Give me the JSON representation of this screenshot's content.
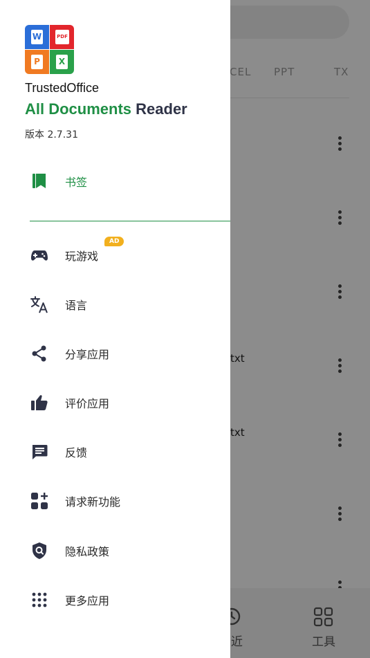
{
  "background": {
    "tabs": [
      "CEL",
      "PPT",
      "TX"
    ],
    "file_suffixes": [
      {
        "text": "txt"
      },
      {
        "text": "txt"
      }
    ],
    "bottom_nav": [
      {
        "label": "近",
        "icon": "clock-icon"
      },
      {
        "label": "工具",
        "icon": "grid-icon"
      }
    ]
  },
  "drawer": {
    "app_name": "TrustedOffice",
    "title_green": "All Documents",
    "title_dark": " Reader",
    "version": "版本 2.7.31",
    "logo": {
      "tiles": [
        {
          "letter": "W",
          "color": "#2b6ed8"
        },
        {
          "letter": "PDF",
          "color": "#e2262c"
        },
        {
          "letter": "P",
          "color": "#f07a22"
        },
        {
          "letter": "X",
          "color": "#2aa14a"
        }
      ]
    },
    "bookmarks": {
      "label": "书签",
      "icon": "bookmark-icon"
    },
    "items": [
      {
        "label": "玩游戏",
        "icon": "gamepad-icon",
        "badge": "AD"
      },
      {
        "label": "语言",
        "icon": "translate-icon"
      },
      {
        "label": "分享应用",
        "icon": "share-icon"
      },
      {
        "label": "评价应用",
        "icon": "thumbs-up-icon"
      },
      {
        "label": "反馈",
        "icon": "feedback-icon"
      },
      {
        "label": "请求新功能",
        "icon": "add-widget-icon"
      },
      {
        "label": "隐私政策",
        "icon": "privacy-shield-icon"
      },
      {
        "label": "更多应用",
        "icon": "apps-grid-icon"
      }
    ],
    "colors": {
      "accent": "#1f8f45",
      "dark": "#2f3347"
    }
  }
}
